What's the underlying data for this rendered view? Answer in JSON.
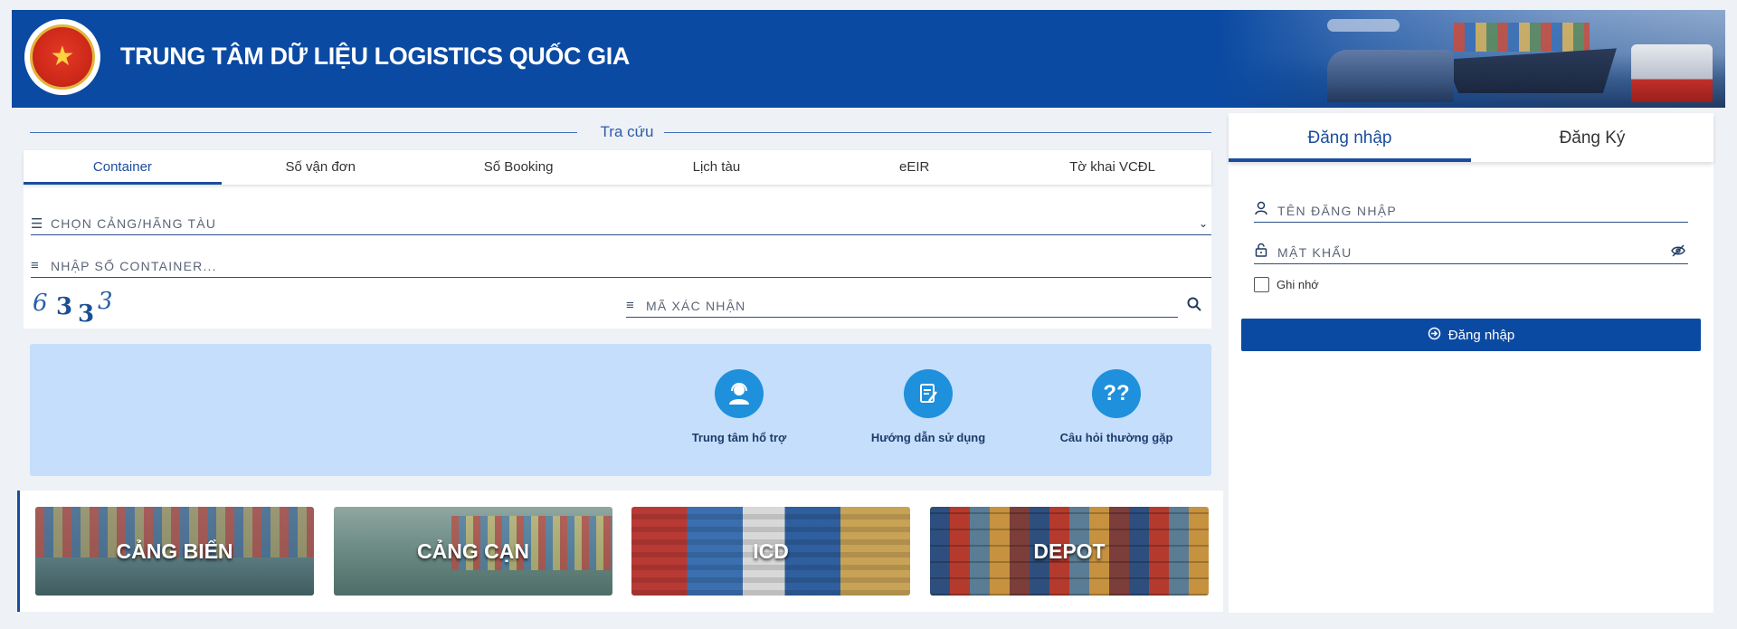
{
  "header": {
    "title": "TRUNG TÂM DỮ LIỆU LOGISTICS QUỐC GIA",
    "emblem_icon": "national-emblem-star"
  },
  "lookup": {
    "section_title": "Tra cứu",
    "tabs": [
      {
        "label": "Container",
        "active": true
      },
      {
        "label": "Số vận đơn",
        "active": false
      },
      {
        "label": "Số Booking",
        "active": false
      },
      {
        "label": "Lịch tàu",
        "active": false
      },
      {
        "label": "eEIR",
        "active": false
      },
      {
        "label": "Tờ khai VCĐL",
        "active": false
      }
    ],
    "port_select_placeholder": "Chọn cảng/hãng tàu",
    "container_input_placeholder": "Nhập số container...",
    "captcha_text": [
      "6",
      "3",
      "3",
      "3"
    ],
    "captcha_input_placeholder": "Mã xác nhận"
  },
  "help": {
    "items": [
      {
        "label": "Trung tâm hổ trợ",
        "icon": "support-agent-icon"
      },
      {
        "label": "Hướng dẫn sử dụng",
        "icon": "guide-document-icon"
      },
      {
        "label": "Câu hỏi thường gặp",
        "icon": "faq-question-icon"
      }
    ]
  },
  "categories": [
    {
      "label": "CẢNG BIỂN"
    },
    {
      "label": "CẢNG CẠN"
    },
    {
      "label": "ICD"
    },
    {
      "label": "DEPOT"
    }
  ],
  "login": {
    "tabs": [
      {
        "label": "Đăng nhập",
        "active": true
      },
      {
        "label": "Đăng Ký",
        "active": false
      }
    ],
    "username_placeholder": "Tên đăng nhập",
    "password_placeholder": "Mật khẩu",
    "remember_label": "Ghi nhớ",
    "submit_label": "Đăng nhập"
  },
  "colors": {
    "primary": "#0b4aa2",
    "accent_tab": "#1a4d9c",
    "help_panel_bg": "#c5defb",
    "help_icon_bg": "#1e90dc",
    "page_bg": "#eef1f6"
  }
}
